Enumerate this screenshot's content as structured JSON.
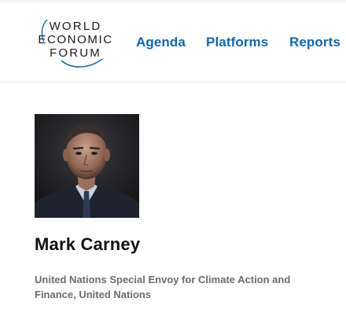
{
  "header": {
    "logo": {
      "line1": "WORLD",
      "line2": "ECONOMIC",
      "line3": "FORUM"
    },
    "nav": [
      {
        "label": "Agenda"
      },
      {
        "label": "Platforms"
      },
      {
        "label": "Reports"
      }
    ],
    "nav_color": "#1467a6"
  },
  "profile": {
    "name": "Mark Carney",
    "title": "United Nations Special Envoy for Climate Action and Finance, United Nations",
    "photo_icon": "portrait-photo"
  }
}
